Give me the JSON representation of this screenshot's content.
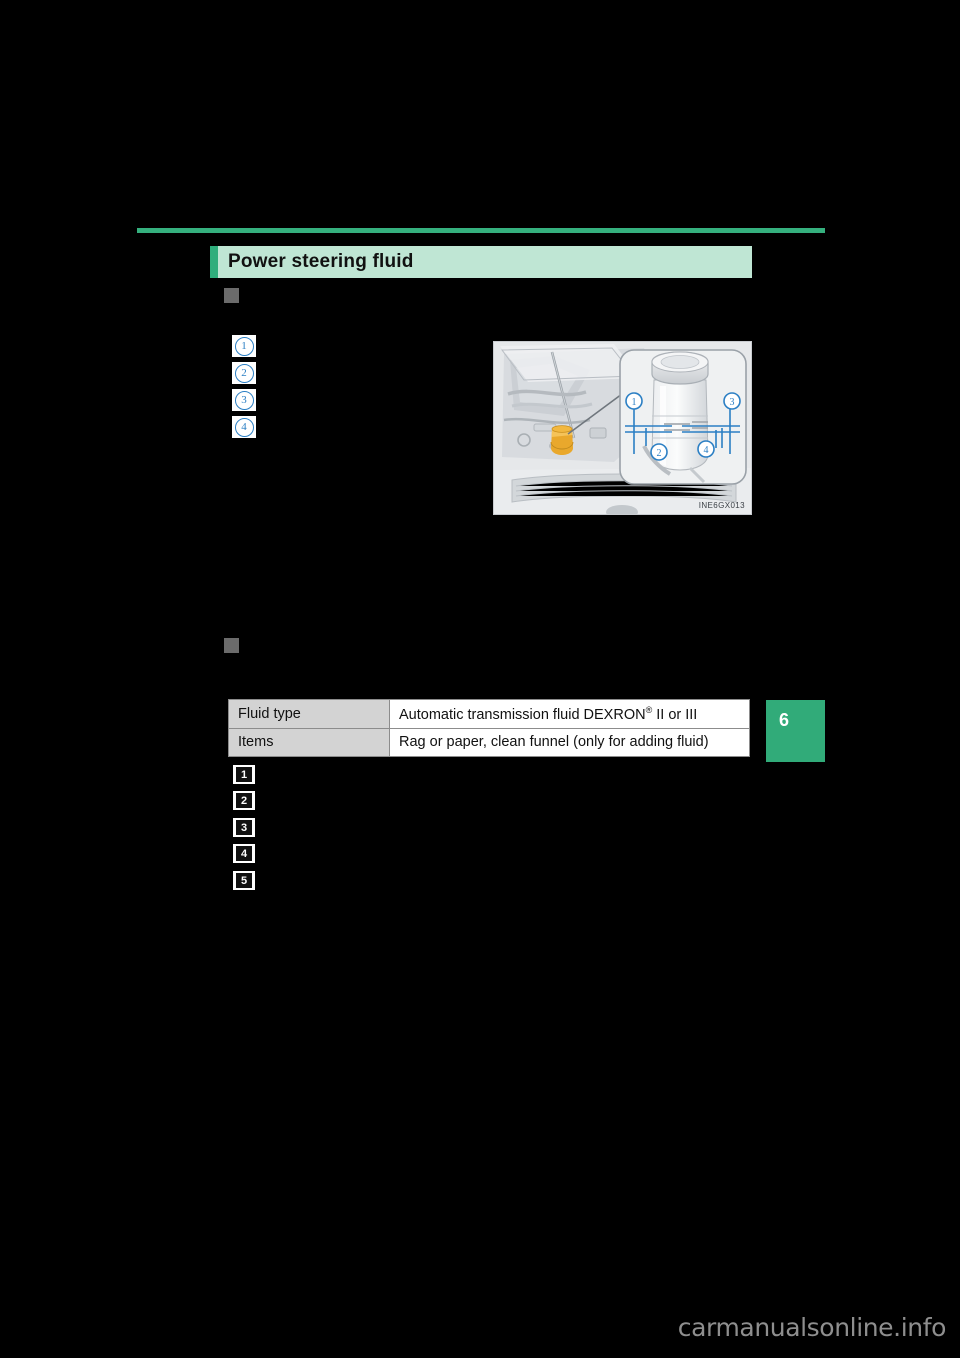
{
  "page": {
    "background_color": "#000000",
    "chapter_tab": {
      "number": "6",
      "color": "#31ab79"
    },
    "watermark": "carmanualsonline.info"
  },
  "section": {
    "title": "Power steering fluid",
    "accent_color": "#2fae7c",
    "band_color": "#bfe6d4",
    "rule_color": "#35b07e"
  },
  "bullets": [
    {
      "name": "heading-bullet-checking",
      "color": "#6b6b6b"
    },
    {
      "name": "heading-bullet-items",
      "color": "#6b6b6b"
    }
  ],
  "callouts": [
    {
      "label": "1",
      "color": "#2b7fc4"
    },
    {
      "label": "2",
      "color": "#2b7fc4"
    },
    {
      "label": "3",
      "color": "#2b7fc4"
    },
    {
      "label": "4",
      "color": "#2b7fc4"
    }
  ],
  "steps": [
    {
      "label": "1"
    },
    {
      "label": "2"
    },
    {
      "label": "3"
    },
    {
      "label": "4"
    },
    {
      "label": "5"
    }
  ],
  "spec_table": {
    "rows": [
      {
        "key": "Fluid type",
        "value_pre": "Automatic transmission fluid DEXRON",
        "value_sup": "®",
        "value_post": " II or III"
      },
      {
        "key": "Items",
        "value_pre": "Rag or paper, clean funnel (only for adding fluid)",
        "value_sup": "",
        "value_post": ""
      }
    ]
  },
  "illustration": {
    "name": "engine-bay-power-steering-reservoir",
    "code": "INE6GX013",
    "callout_labels": [
      "1",
      "2",
      "3",
      "4"
    ],
    "callout_color": "#2b7fc4"
  }
}
